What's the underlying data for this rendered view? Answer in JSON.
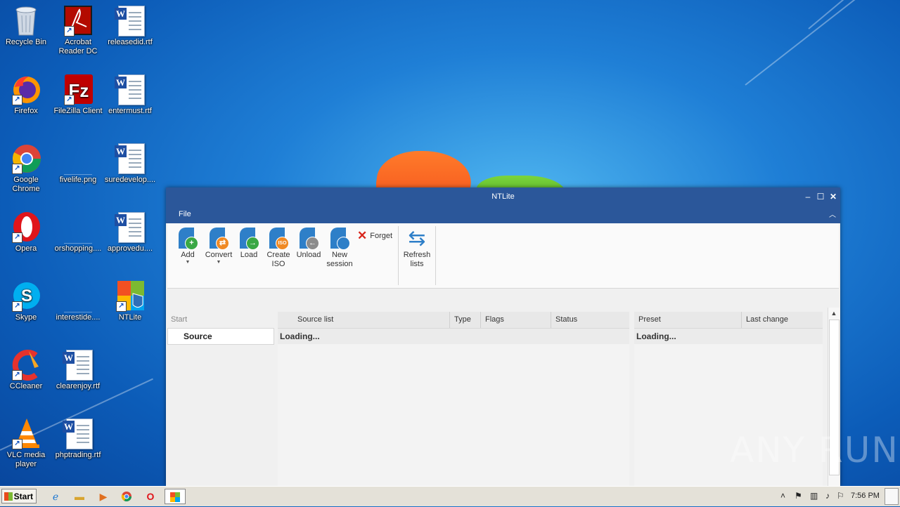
{
  "desktop": {
    "icons": [
      {
        "label": "Recycle Bin"
      },
      {
        "label": "Acrobat Reader DC"
      },
      {
        "label": "releasedid.rtf"
      },
      {
        "label": "Firefox"
      },
      {
        "label": "FileZilla Client"
      },
      {
        "label": "entermust.rtf"
      },
      {
        "label": "Google Chrome"
      },
      {
        "label": "fivelife.png"
      },
      {
        "label": "suredevelop...."
      },
      {
        "label": "Opera"
      },
      {
        "label": "orshopping...."
      },
      {
        "label": "approvedu...."
      },
      {
        "label": "Skype"
      },
      {
        "label": "interestide...."
      },
      {
        "label": "NTLite"
      },
      {
        "label": "CCleaner"
      },
      {
        "label": "clearenjoy.rtf"
      },
      {
        "label": "VLC media player"
      },
      {
        "label": "phptrading.rtf"
      }
    ]
  },
  "window": {
    "title": "NTLite",
    "menu": {
      "file": "File"
    },
    "ribbon": {
      "add": "Add",
      "convert": "Convert",
      "load": "Load",
      "create_iso_1": "Create",
      "create_iso_2": "ISO",
      "unload": "Unload",
      "new_session_1": "New",
      "new_session_2": "session",
      "forget": "Forget",
      "refresh_1": "Refresh",
      "refresh_2": "lists",
      "iso_badge": "ISO"
    },
    "nav": {
      "start": "Start",
      "source": "Source"
    },
    "source_grid": {
      "columns": [
        "Source list",
        "Type",
        "Flags",
        "Status"
      ],
      "loading": "Loading..."
    },
    "preset_grid": {
      "columns": [
        "Preset",
        "Last change"
      ],
      "loading": "Loading..."
    }
  },
  "taskbar": {
    "start": "Start",
    "clock": "7:56 PM"
  },
  "watermark": "ANY RUN"
}
